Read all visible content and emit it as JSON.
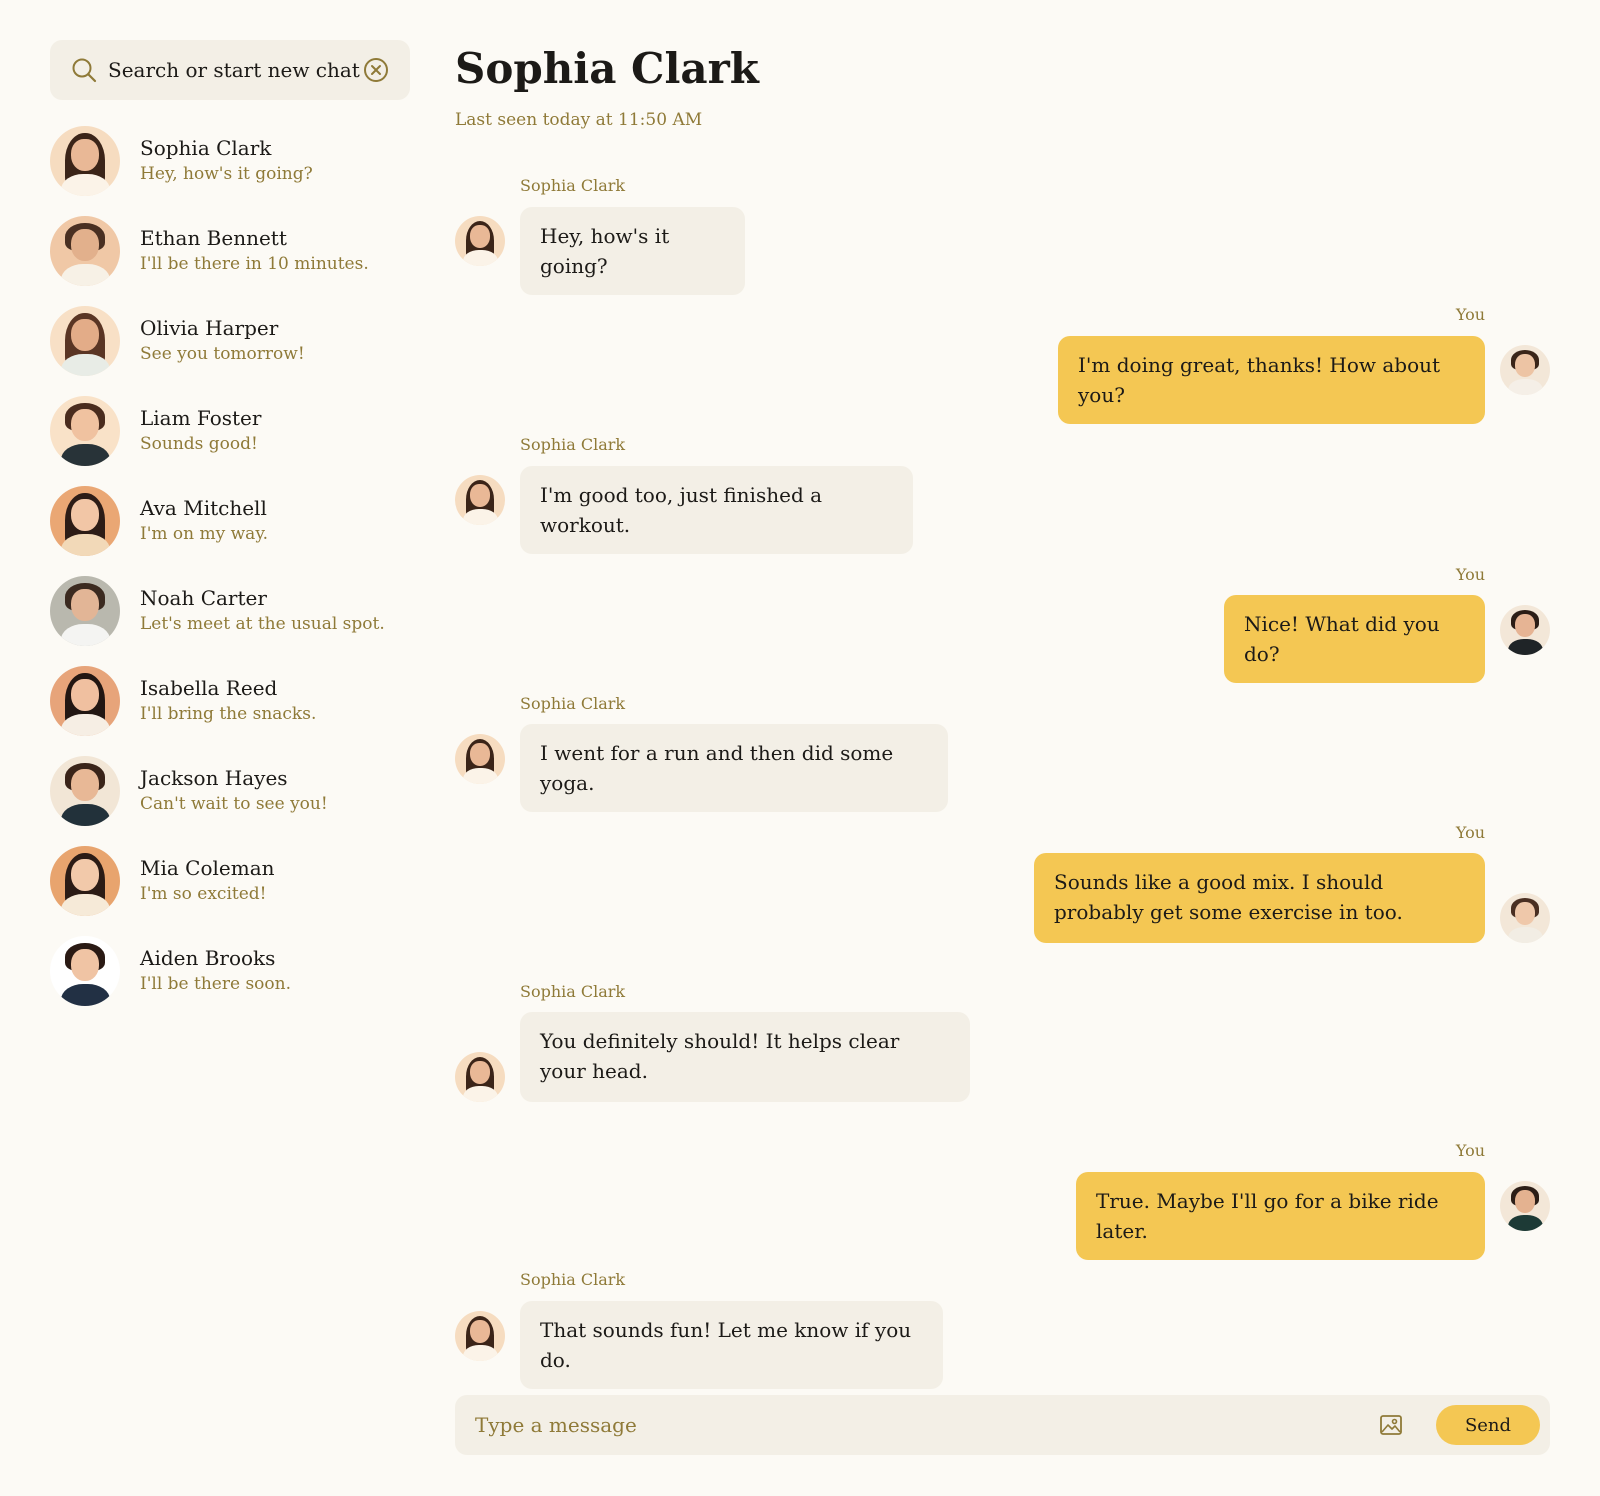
{
  "search": {
    "placeholder": "Search or start new chat"
  },
  "contacts": [
    {
      "name": "Sophia Clark",
      "preview": "Hey, how's it going?",
      "bg": "#f6dcc0",
      "skin": "#e9b896",
      "hair": "#3b2418",
      "shirt": "#fbf3e8",
      "long_hair": true
    },
    {
      "name": "Ethan Bennett",
      "preview": "I'll be there in 10 minutes.",
      "bg": "#f0c8a6",
      "skin": "#e2b08c",
      "hair": "#4a3022",
      "shirt": "#f7f1e6",
      "long_hair": false
    },
    {
      "name": "Olivia Harper",
      "preview": "See you tomorrow!",
      "bg": "#f8e0c6",
      "skin": "#e3ac88",
      "hair": "#5a3524",
      "shirt": "#e8ece6",
      "long_hair": true
    },
    {
      "name": "Liam Foster",
      "preview": "Sounds good!",
      "bg": "#f9e2c8",
      "skin": "#f0c2a0",
      "hair": "#4a2c1e",
      "shirt": "#283338",
      "long_hair": false
    },
    {
      "name": "Ava Mitchell",
      "preview": "I'm on my way.",
      "bg": "#eaa774",
      "skin": "#f2c6a6",
      "hair": "#2d1c16",
      "shirt": "#f2d9b8",
      "long_hair": true
    },
    {
      "name": "Noah Carter",
      "preview": "Let's meet at the usual spot.",
      "bg": "#b9b8ae",
      "skin": "#e2b596",
      "hair": "#3b2a20",
      "shirt": "#f4f4f2",
      "long_hair": false
    },
    {
      "name": "Isabella Reed",
      "preview": "I'll bring the snacks.",
      "bg": "#e7a47a",
      "skin": "#f0c0a0",
      "hair": "#221612",
      "shirt": "#f6eee4",
      "long_hair": true
    },
    {
      "name": "Jackson Hayes",
      "preview": "Can't wait to see you!",
      "bg": "#f2e6d6",
      "skin": "#e8b896",
      "hair": "#3a2419",
      "shirt": "#22313a",
      "long_hair": false
    },
    {
      "name": "Mia Coleman",
      "preview": "I'm so excited!",
      "bg": "#e8a46e",
      "skin": "#f2c9aa",
      "hair": "#2b1b15",
      "shirt": "#f6ead8",
      "long_hair": true
    },
    {
      "name": "Aiden Brooks",
      "preview": "I'll be there soon.",
      "bg": "#ffffff",
      "skin": "#f0c4a4",
      "hair": "#2a1a14",
      "shirt": "#223044",
      "long_hair": false
    }
  ],
  "chat": {
    "title": "Sophia Clark",
    "last_seen": "Last seen today at 11:50 AM",
    "messages": [
      {
        "direction": "in",
        "sender": "Sophia Clark",
        "text": "Hey, how's it going?"
      },
      {
        "direction": "out",
        "sender": "You",
        "text": "I'm doing great, thanks! How about you?"
      },
      {
        "direction": "in",
        "sender": "Sophia Clark",
        "text": "I'm good too, just finished a workout."
      },
      {
        "direction": "out",
        "sender": "You",
        "text": "Nice! What did you do?"
      },
      {
        "direction": "in",
        "sender": "Sophia Clark",
        "text": "I went for a run and then did some yoga."
      },
      {
        "direction": "out",
        "sender": "You",
        "text": "Sounds like a good mix. I should probably get some exercise in too."
      },
      {
        "direction": "in",
        "sender": "Sophia Clark",
        "text": "You definitely should! It helps clear your head."
      },
      {
        "direction": "out",
        "sender": "You",
        "text": "True. Maybe I'll go for a bike ride later."
      },
      {
        "direction": "in",
        "sender": "Sophia Clark",
        "text": "That sounds fun! Let me know if you do."
      }
    ]
  },
  "composer": {
    "placeholder": "Type a message",
    "send_label": "Send",
    "image_icon": "image-icon"
  },
  "colors": {
    "accent": "#f4c753",
    "muted_text": "#8f7a38",
    "panel": "#f3efe6",
    "background": "#fcfaf5"
  }
}
